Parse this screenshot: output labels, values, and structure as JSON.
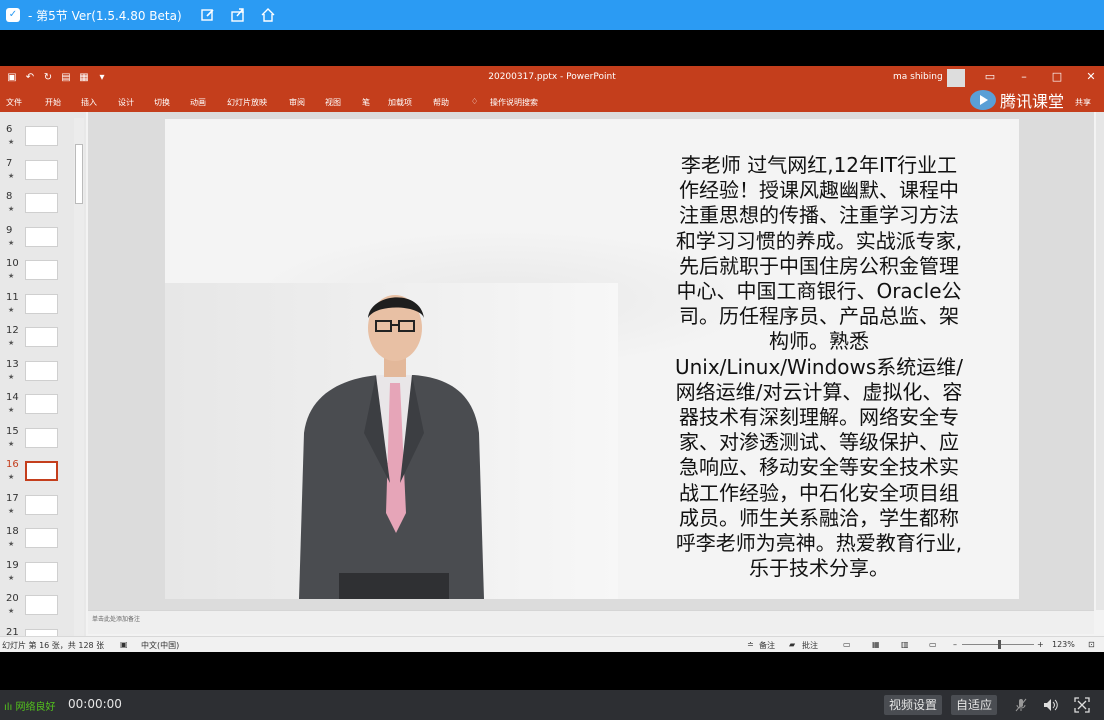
{
  "app": {
    "title": "- 第5节 Ver(1.5.4.80 Beta)",
    "net_status": "网络良好",
    "timer": "00:00:00",
    "video_settings_label": "视频设置",
    "adapt_label": "自适应"
  },
  "ppt": {
    "document_title": "20200317.pptx  -  PowerPoint",
    "user_name": "ma shibing",
    "ribbon_tabs": [
      "文件",
      "开始",
      "插入",
      "设计",
      "切换",
      "动画",
      "幻灯片放映",
      "审阅",
      "视图",
      "笔",
      "加载项",
      "帮助",
      "操作说明搜索"
    ],
    "tencent_brand": "腾讯课堂",
    "share_label": "共享",
    "slide_thumbnails": [
      {
        "num": "6",
        "star": "★"
      },
      {
        "num": "7",
        "star": "★"
      },
      {
        "num": "8",
        "star": "★"
      },
      {
        "num": "9",
        "star": "★"
      },
      {
        "num": "10",
        "star": "★"
      },
      {
        "num": "11",
        "star": "★"
      },
      {
        "num": "12",
        "star": "★"
      },
      {
        "num": "13",
        "star": "★"
      },
      {
        "num": "14",
        "star": "★"
      },
      {
        "num": "15",
        "star": "★"
      },
      {
        "num": "16",
        "star": "★"
      },
      {
        "num": "17",
        "star": "★"
      },
      {
        "num": "18",
        "star": "★"
      },
      {
        "num": "19",
        "star": "★"
      },
      {
        "num": "20",
        "star": "★"
      },
      {
        "num": "21",
        "star": ""
      }
    ],
    "active_slide": "16",
    "slide_bio_lines": [
      "李老师  过气网红,12年IT行业工",
      "作经验！授课风趣幽默、课程中",
      "注重思想的传播、注重学习方法",
      "和学习习惯的养成。实战派专家,",
      "先后就职于中国住房公积金管理",
      "中心、中国工商银行、Oracle公",
      "司。历任程序员、产品总监、架",
      "构师。熟悉",
      "Unix/Linux/Windows系统运维/",
      "网络运维/对云计算、虚拟化、容",
      "器技术有深刻理解。网络安全专",
      "家、对渗透测试、等级保护、应",
      "急响应、移动安全等安全技术实",
      "战工作经验，中石化安全项目组",
      "成员。师生关系融洽，学生都称",
      "呼李老师为亮神。热爱教育行业,",
      "乐于技术分享。"
    ],
    "notes_placeholder": "单击此处添加备注",
    "status": {
      "slide_info": "幻灯片 第 16 张，共 128 张",
      "language": "中文(中国)",
      "notes_label": "备注",
      "comments_label": "批注",
      "zoom": "123%"
    }
  }
}
